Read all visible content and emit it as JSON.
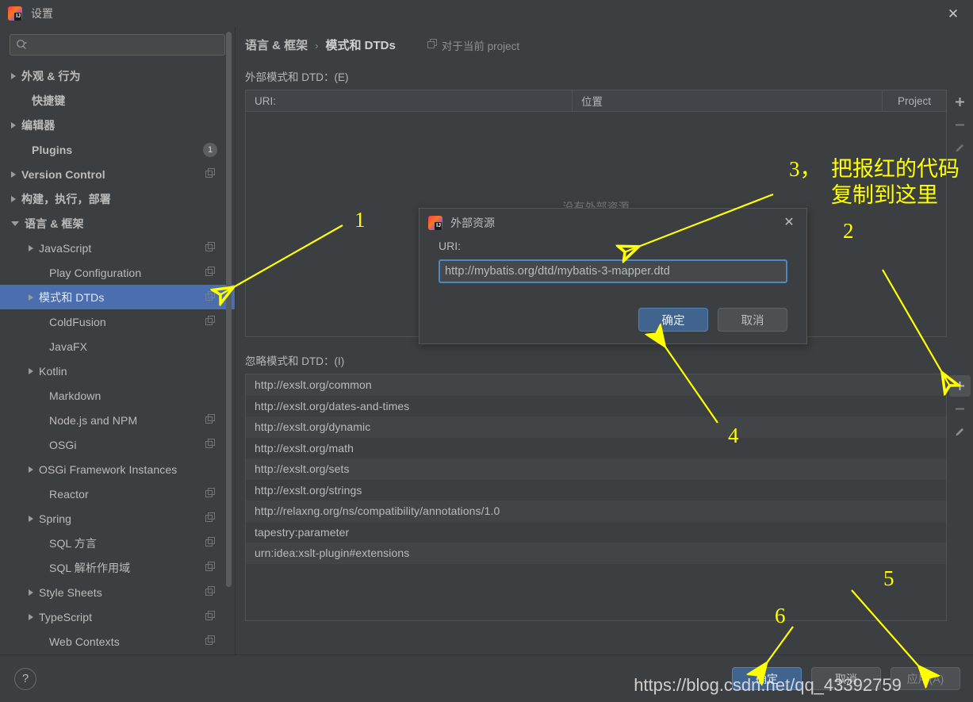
{
  "window": {
    "title": "设置",
    "close_label": "✕",
    "logo_icon": "intellij-idea-logo"
  },
  "sidebar": {
    "search": {
      "placeholder": "",
      "value": "",
      "icon": "search-icon"
    },
    "items": [
      {
        "label": "外观 & 行为",
        "level": 0,
        "arrow": "right",
        "bold": true,
        "copy": false,
        "badge": ""
      },
      {
        "label": "快捷键",
        "level": 0,
        "arrow": "none",
        "bold": true,
        "copy": false,
        "badge": ""
      },
      {
        "label": "编辑器",
        "level": 0,
        "arrow": "right",
        "bold": true,
        "copy": false,
        "badge": ""
      },
      {
        "label": "Plugins",
        "level": 0,
        "arrow": "none",
        "bold": true,
        "copy": false,
        "badge": "1"
      },
      {
        "label": "Version Control",
        "level": 0,
        "arrow": "right",
        "bold": true,
        "copy": true,
        "badge": ""
      },
      {
        "label": "构建，执行，部署",
        "level": 0,
        "arrow": "right",
        "bold": true,
        "copy": false,
        "badge": ""
      },
      {
        "label": "语言 & 框架",
        "level": 0,
        "arrow": "down",
        "bold": true,
        "copy": false,
        "badge": ""
      },
      {
        "label": "JavaScript",
        "level": 1,
        "arrow": "right",
        "bold": false,
        "copy": true,
        "badge": ""
      },
      {
        "label": "Play Configuration",
        "level": 1,
        "arrow": "none",
        "bold": false,
        "copy": true,
        "badge": ""
      },
      {
        "label": "模式和 DTDs",
        "level": 1,
        "arrow": "right",
        "bold": false,
        "copy": true,
        "badge": "",
        "selected": true
      },
      {
        "label": "ColdFusion",
        "level": 1,
        "arrow": "none",
        "bold": false,
        "copy": true,
        "badge": ""
      },
      {
        "label": "JavaFX",
        "level": 1,
        "arrow": "none",
        "bold": false,
        "copy": false,
        "badge": ""
      },
      {
        "label": "Kotlin",
        "level": 1,
        "arrow": "right",
        "bold": false,
        "copy": false,
        "badge": ""
      },
      {
        "label": "Markdown",
        "level": 1,
        "arrow": "none",
        "bold": false,
        "copy": false,
        "badge": ""
      },
      {
        "label": "Node.js and NPM",
        "level": 1,
        "arrow": "none",
        "bold": false,
        "copy": true,
        "badge": ""
      },
      {
        "label": "OSGi",
        "level": 1,
        "arrow": "none",
        "bold": false,
        "copy": true,
        "badge": ""
      },
      {
        "label": "OSGi Framework Instances",
        "level": 1,
        "arrow": "right",
        "bold": false,
        "copy": false,
        "badge": ""
      },
      {
        "label": "Reactor",
        "level": 1,
        "arrow": "none",
        "bold": false,
        "copy": true,
        "badge": ""
      },
      {
        "label": "Spring",
        "level": 1,
        "arrow": "right",
        "bold": false,
        "copy": true,
        "badge": ""
      },
      {
        "label": "SQL 方言",
        "level": 1,
        "arrow": "none",
        "bold": false,
        "copy": true,
        "badge": ""
      },
      {
        "label": "SQL 解析作用域",
        "level": 1,
        "arrow": "none",
        "bold": false,
        "copy": true,
        "badge": ""
      },
      {
        "label": "Style Sheets",
        "level": 1,
        "arrow": "right",
        "bold": false,
        "copy": true,
        "badge": ""
      },
      {
        "label": "TypeScript",
        "level": 1,
        "arrow": "right",
        "bold": false,
        "copy": true,
        "badge": ""
      },
      {
        "label": "Web Contexts",
        "level": 1,
        "arrow": "none",
        "bold": false,
        "copy": true,
        "badge": ""
      }
    ]
  },
  "main": {
    "breadcrumb": {
      "parent": "语言 & 框架",
      "separator": "›",
      "current": "模式和 DTDs"
    },
    "scope": {
      "label": "对于当前 project",
      "icon": "copy-icon"
    },
    "external": {
      "section_label": "外部模式和 DTD：(E)",
      "columns": [
        "URI:",
        "位置",
        "Project"
      ],
      "rows": [],
      "empty_text": "没有外部资源",
      "tools": [
        {
          "icon": "plus-icon",
          "label": "+"
        },
        {
          "icon": "minus-icon",
          "label": "−"
        },
        {
          "icon": "pencil-icon",
          "label": "✎"
        }
      ]
    },
    "ignored": {
      "section_label": "忽略模式和 DTD：(I)",
      "rows": [
        "http://exslt.org/common",
        "http://exslt.org/dates-and-times",
        "http://exslt.org/dynamic",
        "http://exslt.org/math",
        "http://exslt.org/sets",
        "http://exslt.org/strings",
        "http://relaxng.org/ns/compatibility/annotations/1.0",
        "tapestry:parameter",
        "urn:idea:xslt-plugin#extensions"
      ],
      "tools": [
        {
          "icon": "plus-icon",
          "label": "+"
        },
        {
          "icon": "minus-icon",
          "label": "−"
        },
        {
          "icon": "pencil-icon",
          "label": "✎"
        }
      ]
    }
  },
  "dialog": {
    "title": "外部资源",
    "logo_icon": "intellij-idea-logo",
    "close_label": "✕",
    "uri_label": "URI:",
    "uri_value": "http://mybatis.org/dtd/mybatis-3-mapper.dtd",
    "uri_placeholder": "",
    "ok_label": "确定",
    "cancel_label": "取消"
  },
  "footer": {
    "help_label": "?",
    "ok_label": "确定",
    "cancel_label": "取消",
    "apply_label": "应用(A)"
  },
  "annotations": {
    "n1": "1",
    "n2": "2",
    "n3": "3，",
    "n3_text_line1": "把报红的代码",
    "n3_text_line2": "复制到这里",
    "n4": "4",
    "n5": "5",
    "n6": "6",
    "watermark": "https://blog.csdn.net/qq_43392759",
    "color": "#ffff00"
  }
}
